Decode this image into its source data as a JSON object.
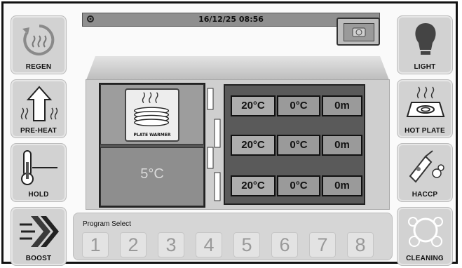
{
  "status_bar": {
    "datetime": "16/12/25 08:56"
  },
  "left_buttons": [
    {
      "label": "REGEN",
      "icon": "regen-icon"
    },
    {
      "label": "PRE-HEAT",
      "icon": "preheat-arrow-icon"
    },
    {
      "label": "HOLD",
      "icon": "thermometer-icon"
    },
    {
      "label": "BOOST",
      "icon": "boost-chevrons-icon"
    }
  ],
  "right_buttons": [
    {
      "label": "LIGHT",
      "icon": "lightbulb-icon"
    },
    {
      "label": "HOT PLATE",
      "icon": "hot-plate-icon"
    },
    {
      "label": "HACCP",
      "icon": "haccp-icon"
    },
    {
      "label": "CLEANING",
      "icon": "cleaning-bubbles-icon"
    }
  ],
  "cabinet": {
    "plate_warmer_label": "PLATE WARMER",
    "lower_temp": "5°C",
    "shelves": [
      {
        "temp": "20°C",
        "set": "0°C",
        "time": "0m"
      },
      {
        "temp": "20°C",
        "set": "0°C",
        "time": "0m"
      },
      {
        "temp": "20°C",
        "set": "0°C",
        "time": "0m"
      }
    ]
  },
  "program_select": {
    "title": "Program Select",
    "programs": [
      "1",
      "2",
      "3",
      "4",
      "5",
      "6",
      "7",
      "8"
    ]
  }
}
